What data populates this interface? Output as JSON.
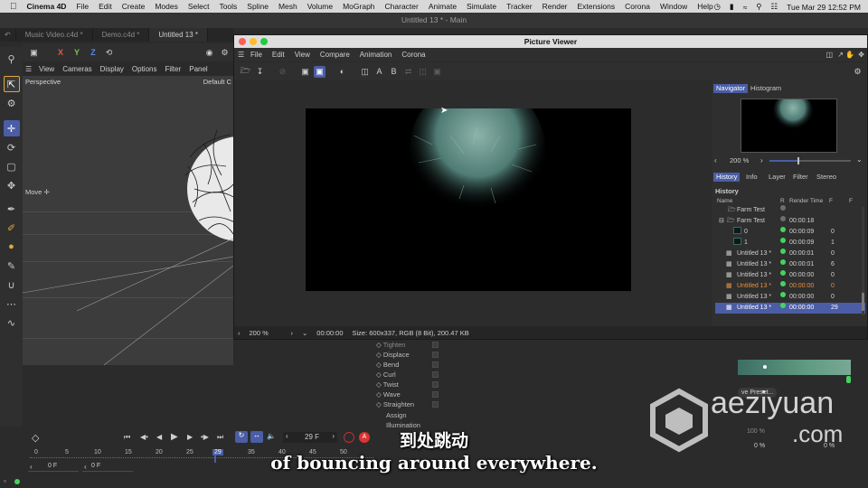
{
  "menubar": {
    "app": "Cinema 4D",
    "items": [
      "File",
      "Edit",
      "Create",
      "Modes",
      "Select",
      "Tools",
      "Spline",
      "Mesh",
      "Volume",
      "MoGraph",
      "Character",
      "Animate",
      "Simulate",
      "Tracker",
      "Render",
      "Extensions",
      "Corona",
      "Window",
      "Help"
    ],
    "datetime": "Tue Mar 29  12:52 PM"
  },
  "window_title": "Untitled 13 * - Main",
  "doc_tabs": [
    "Music Video.c4d *",
    "Demo.c4d *",
    "Untitled 13 *"
  ],
  "viewport": {
    "menu": [
      "View",
      "Cameras",
      "Display",
      "Options",
      "Filter",
      "Panel"
    ],
    "camera_label": "Perspective",
    "default_label": "Default C",
    "move_label": "Move"
  },
  "axis_buttons": [
    "X",
    "Y",
    "Z"
  ],
  "picture_viewer": {
    "title": "Picture Viewer",
    "menu": [
      "File",
      "Edit",
      "View",
      "Compare",
      "Animation",
      "Corona"
    ],
    "tool_letters": [
      "A",
      "B"
    ],
    "status": {
      "zoom": "200 %",
      "time": "00:00:00",
      "info": "Size: 600x337, RGB (8 Bit), 200.47 KB"
    },
    "nav_tabs": [
      "Navigator",
      "Histogram"
    ],
    "nav_zoom": "200 %",
    "info_tabs": [
      "History",
      "Info",
      "Layer",
      "Filter",
      "Stereo"
    ],
    "history_heading": "History",
    "history_columns": [
      "Name",
      "R",
      "Render Time",
      "F",
      "F"
    ],
    "history_rows": [
      {
        "name": "Farm Test",
        "time": "",
        "f": "",
        "kind": "folder",
        "dot": "grey",
        "style": ""
      },
      {
        "name": "Farm Test",
        "time": "00:00:18",
        "f": "",
        "kind": "folder",
        "dot": "grey",
        "style": ""
      },
      {
        "name": "0",
        "time": "00:00:09",
        "f": "0",
        "kind": "frame",
        "dot": "green",
        "style": ""
      },
      {
        "name": "1",
        "time": "00:00:09",
        "f": "1",
        "kind": "frame",
        "dot": "green",
        "style": ""
      },
      {
        "name": "Untitled 13 *",
        "time": "00:00:01",
        "f": "0",
        "kind": "doc",
        "dot": "green",
        "style": ""
      },
      {
        "name": "Untitled 13 *",
        "time": "00:00:01",
        "f": "6",
        "kind": "doc",
        "dot": "green",
        "style": ""
      },
      {
        "name": "Untitled 13 *",
        "time": "00:00:00",
        "f": "0",
        "kind": "doc",
        "dot": "green",
        "style": ""
      },
      {
        "name": "Untitled 13 *",
        "time": "00:00:00",
        "f": "0",
        "kind": "doc",
        "dot": "green",
        "style": "orange"
      },
      {
        "name": "Untitled 13 *",
        "time": "00:00:00",
        "f": "0",
        "kind": "doc",
        "dot": "green",
        "style": ""
      },
      {
        "name": "Untitled 13 *",
        "time": "00:00:00",
        "f": "29",
        "kind": "doc",
        "dot": "green",
        "style": "sel"
      }
    ]
  },
  "attributes": [
    "Tighten",
    "Displace",
    "Bend",
    "Curl",
    "Twist",
    "Wave",
    "Straighten",
    "Assign",
    "Illumination"
  ],
  "right_panel": {
    "preset_button": "ve Preset...",
    "pct1": "100 %",
    "pct2": "0 %",
    "pct3": "0 %"
  },
  "timeline": {
    "ticks": [
      "0",
      "5",
      "10",
      "15",
      "20",
      "25",
      "29",
      "35",
      "40",
      "45",
      "50"
    ],
    "frame_field": "29 F",
    "start_field": "0 F",
    "end_field": "0 F"
  },
  "subtitles": {
    "cn": "到处跳动",
    "en": "of bouncing around everywhere."
  },
  "watermark": {
    "name": "aeziyuan",
    "domain": ".com"
  },
  "colors": {
    "accent": "#4a5da5",
    "render_dot": "#45d35f",
    "highlight_orange": "#e8913a",
    "gradient_green": "#5f9a82"
  }
}
